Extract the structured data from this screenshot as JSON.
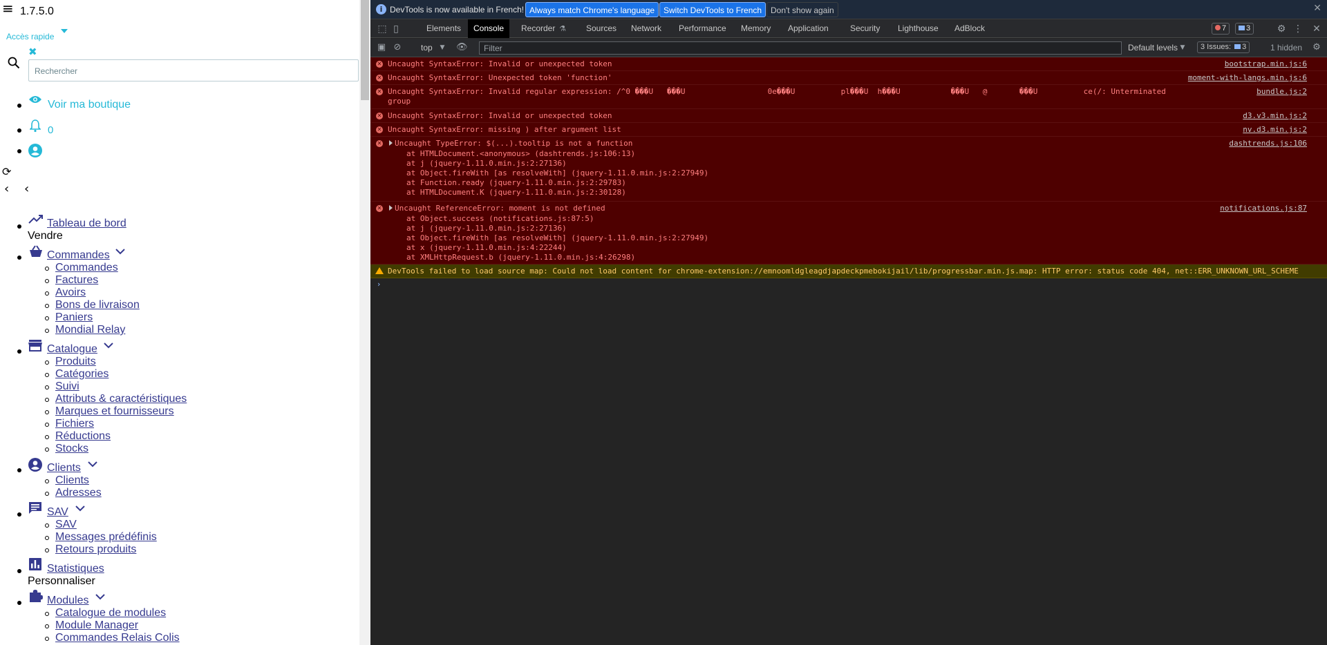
{
  "left_page": {
    "version": "1.7.5.0",
    "quick_access": "Accès rapide",
    "search_placeholder": "Rechercher",
    "header_links": {
      "shop": "Voir ma boutique",
      "notifications": "0"
    },
    "menu": {
      "dashboard": "Tableau de bord",
      "sell_heading": "Vendre",
      "orders": {
        "label": "Commandes",
        "children": [
          "Commandes",
          "Factures",
          "Avoirs",
          "Bons de livraison",
          "Paniers",
          "Mondial Relay"
        ]
      },
      "catalog": {
        "label": "Catalogue",
        "children": [
          "Produits",
          "Catégories",
          "Suivi",
          "Attributs & caractéristiques",
          "Marques et fournisseurs",
          "Fichiers",
          "Réductions",
          "Stocks"
        ]
      },
      "customers": {
        "label": "Clients",
        "children": [
          "Clients",
          "Adresses"
        ]
      },
      "sav": {
        "label": "SAV",
        "children": [
          "SAV",
          "Messages prédéfinis",
          "Retours produits"
        ]
      },
      "stats": "Statistiques",
      "customize_heading": "Personnaliser",
      "modules": {
        "label": "Modules",
        "children": [
          "Catalogue de modules",
          "Module Manager",
          "Commandes Relais Colis"
        ]
      }
    }
  },
  "devtools": {
    "infobar": {
      "message": "DevTools is now available in French!",
      "btn_match": "Always match Chrome's language",
      "btn_switch": "Switch DevTools to French",
      "btn_dismiss": "Don't show again"
    },
    "tabs": [
      "Elements",
      "Console",
      "Recorder",
      "Sources",
      "Network",
      "Performance",
      "Memory",
      "Application",
      "Security",
      "Lighthouse",
      "AdBlock"
    ],
    "active_tab": "Console",
    "error_count": "7",
    "message_count": "3",
    "toolbar": {
      "context": "top",
      "filter_placeholder": "Filter",
      "levels": "Default levels",
      "issues_label": "3 Issues:",
      "issues_count": "3",
      "hidden": "1 hidden"
    },
    "messages": [
      {
        "text": "Uncaught SyntaxError: Invalid or unexpected token",
        "source": "bootstrap.min.js:6"
      },
      {
        "text": "Uncaught SyntaxError: Unexpected token 'function'",
        "source": "moment-with-langs.min.js:6"
      },
      {
        "text": "Uncaught SyntaxError: Invalid regular expression: /^0 ���U   ���U                  0e���U          pl���U  h���U           ���U   @       ���U          ce(/: Unterminated\ngroup",
        "source": "bundle.js:2"
      },
      {
        "text": "Uncaught SyntaxError: Invalid or unexpected token",
        "source": "d3.v3.min.js:2"
      },
      {
        "text": "Uncaught SyntaxError: missing ) after argument list",
        "source": "nv.d3.min.js:2"
      },
      {
        "text": "Uncaught TypeError: $(...).tooltip is not a function",
        "source": "dashtrends.js:106",
        "stack": [
          "at HTMLDocument.<anonymous> (dashtrends.js:106:13)",
          "at j (jquery-1.11.0.min.js:2:27136)",
          "at Object.fireWith [as resolveWith] (jquery-1.11.0.min.js:2:27949)",
          "at Function.ready (jquery-1.11.0.min.js:2:29783)",
          "at HTMLDocument.K (jquery-1.11.0.min.js:2:30128)"
        ]
      },
      {
        "text": "Uncaught ReferenceError: moment is not defined",
        "source": "notifications.js:87",
        "stack": [
          "at Object.success (notifications.js:87:5)",
          "at j (jquery-1.11.0.min.js:2:27136)",
          "at Object.fireWith [as resolveWith] (jquery-1.11.0.min.js:2:27949)",
          "at x (jquery-1.11.0.min.js:4:22244)",
          "at XMLHttpRequest.b (jquery-1.11.0.min.js:4:26298)"
        ]
      }
    ],
    "warning": "DevTools failed to load source map: Could not load content for chrome-extension://emnoomldgleagdjapdeckpmebokijail/lib/progressbar.min.js.map: HTTP error: status code 404, net::ERR_UNKNOWN_URL_SCHEME",
    "prompt": "›"
  }
}
